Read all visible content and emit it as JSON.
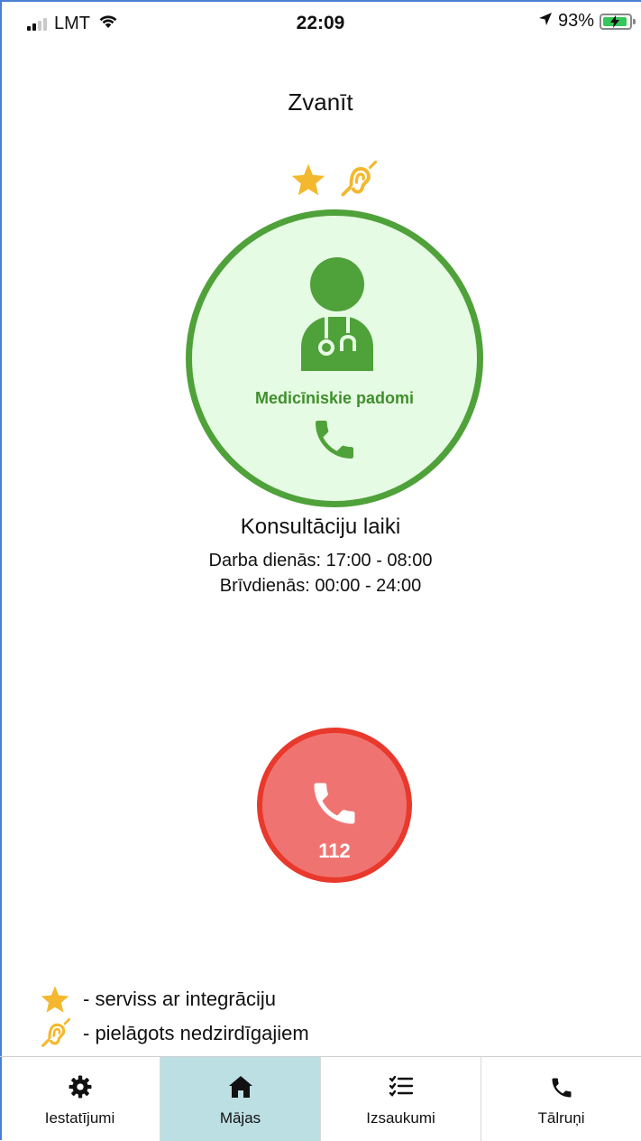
{
  "status_bar": {
    "carrier": "LMT",
    "time": "22:09",
    "battery_percent": "93%",
    "battery_level": 0.93,
    "icons": [
      "signal-icon",
      "wifi-icon",
      "location-arrow-icon",
      "battery-charging-icon"
    ]
  },
  "header": {
    "title": "Zvanīt"
  },
  "service": {
    "label": "Medicīniskie padomi",
    "badges": [
      "star-icon",
      "hearing-impaired-icon"
    ],
    "colors": {
      "accent": "#4fa13a",
      "background": "#e6fbe3"
    }
  },
  "hours": {
    "title": "Konsultāciju laiki",
    "lines": [
      "Darba dienās: 17:00 - 08:00",
      "Brīvdienās: 00:00 - 24:00"
    ]
  },
  "emergency": {
    "number": "112",
    "colors": {
      "fill": "#ef7471",
      "border": "#e8392c"
    }
  },
  "legend": {
    "items": [
      {
        "icon": "star-icon",
        "text": "- serviss ar integrāciju"
      },
      {
        "icon": "hearing-impaired-icon",
        "text": "- pielāgots nedzirdīgajiem"
      }
    ]
  },
  "tabs": [
    {
      "label": "Iestatījumi",
      "icon": "gear-icon",
      "active": false
    },
    {
      "label": "Mājas",
      "icon": "home-icon",
      "active": true
    },
    {
      "label": "Izsaukumi",
      "icon": "checklist-icon",
      "active": false
    },
    {
      "label": "Tālruņi",
      "icon": "phone-icon",
      "active": false
    }
  ]
}
